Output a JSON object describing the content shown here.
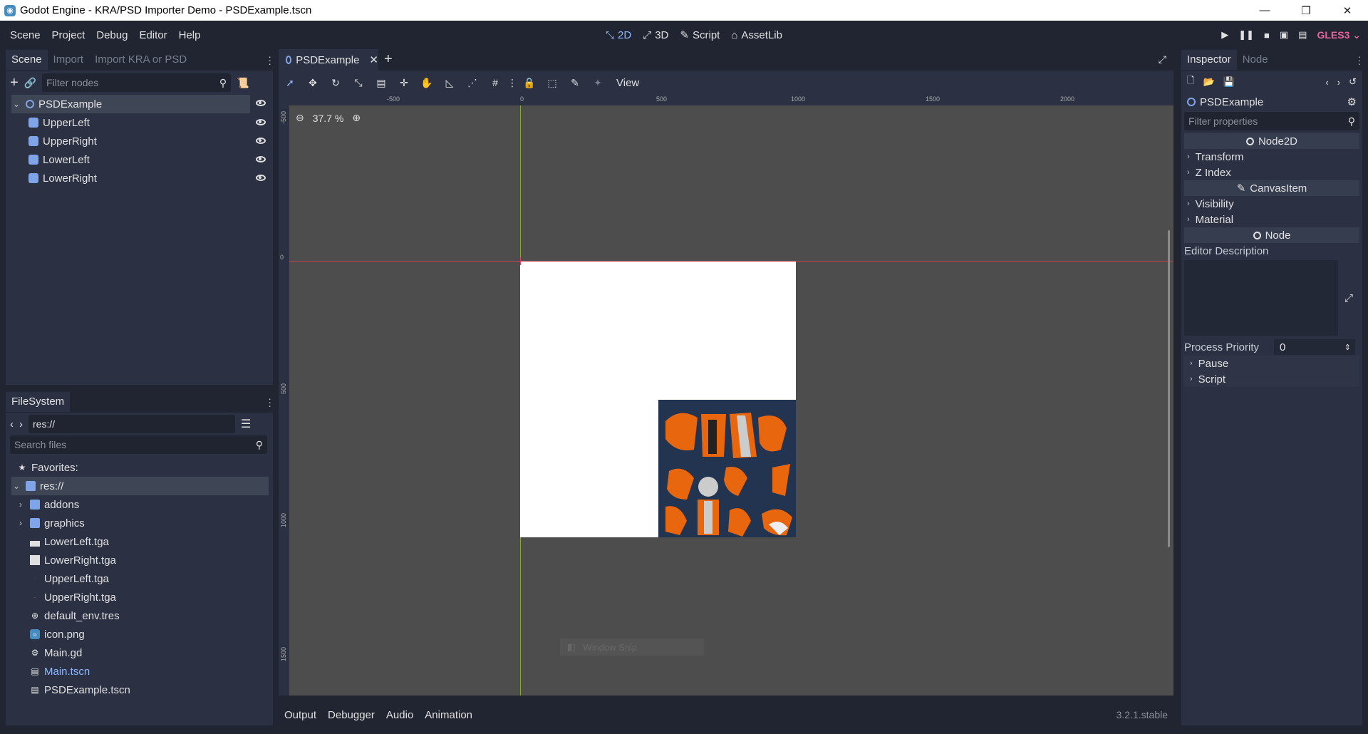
{
  "window": {
    "title": "Godot Engine - KRA/PSD Importer Demo - PSDExample.tscn",
    "minimize": "—",
    "restore": "❐",
    "close": "✕"
  },
  "menubar": {
    "items": [
      "Scene",
      "Project",
      "Debug",
      "Editor",
      "Help"
    ]
  },
  "workspaces": [
    {
      "label": "2D",
      "icon": "2d-icon",
      "active": true
    },
    {
      "label": "3D",
      "icon": "3d-icon",
      "active": false
    },
    {
      "label": "Script",
      "icon": "script-icon",
      "active": false
    },
    {
      "label": "AssetLib",
      "icon": "assetlib-icon",
      "active": false
    }
  ],
  "renderer": "GLES3",
  "scene_dock": {
    "tabs": [
      "Scene",
      "Import",
      "Import KRA or PSD"
    ],
    "filter_placeholder": "Filter nodes",
    "nodes": [
      {
        "name": "PSDExample",
        "type": "node2d",
        "root": true
      },
      {
        "name": "UpperLeft",
        "type": "sprite"
      },
      {
        "name": "UpperRight",
        "type": "sprite"
      },
      {
        "name": "LowerLeft",
        "type": "sprite"
      },
      {
        "name": "LowerRight",
        "type": "sprite"
      }
    ]
  },
  "filesystem_dock": {
    "tab": "FileSystem",
    "path": "res://",
    "search_placeholder": "Search files",
    "favorites_label": "Favorites:",
    "root_label": "res://",
    "entries": [
      {
        "name": "addons",
        "kind": "folder"
      },
      {
        "name": "graphics",
        "kind": "folder"
      },
      {
        "name": "LowerLeft.tga",
        "kind": "image"
      },
      {
        "name": "LowerRight.tga",
        "kind": "image"
      },
      {
        "name": "UpperLeft.tga",
        "kind": "image"
      },
      {
        "name": "UpperRight.tga",
        "kind": "image"
      },
      {
        "name": "default_env.tres",
        "kind": "resource"
      },
      {
        "name": "icon.png",
        "kind": "image"
      },
      {
        "name": "Main.gd",
        "kind": "script"
      },
      {
        "name": "Main.tscn",
        "kind": "scene",
        "highlight": true
      },
      {
        "name": "PSDExample.tscn",
        "kind": "scene"
      }
    ]
  },
  "editor": {
    "scene_tab": "PSDExample",
    "view_menu": "View",
    "zoom": "37.7 %",
    "ruler_h": [
      "-500",
      "0",
      "500",
      "1000",
      "1500",
      "2000"
    ],
    "ruler_v": [
      "-500",
      "0",
      "500",
      "1000",
      "1500"
    ],
    "ghost_label": "Window Snip"
  },
  "bottom_panel": {
    "tabs": [
      "Output",
      "Debugger",
      "Audio",
      "Animation"
    ],
    "version": "3.2.1.stable"
  },
  "inspector": {
    "tabs": [
      "Inspector",
      "Node"
    ],
    "object_name": "PSDExample",
    "filter_placeholder": "Filter properties",
    "sections": [
      {
        "title": "Node2D",
        "rows": [
          "Transform",
          "Z Index"
        ]
      },
      {
        "title": "CanvasItem",
        "rows": [
          "Visibility",
          "Material"
        ]
      },
      {
        "title": "Node",
        "rows": []
      }
    ],
    "editor_description_label": "Editor Description",
    "process_priority_label": "Process Priority",
    "process_priority_value": "0",
    "extra_rows": [
      "Pause",
      "Script"
    ]
  },
  "colors": {
    "accent": "#8eb7ff",
    "panel": "#2b3142",
    "background": "#202531",
    "viewport": "#4d4d4d",
    "gles": "#e6649c"
  }
}
